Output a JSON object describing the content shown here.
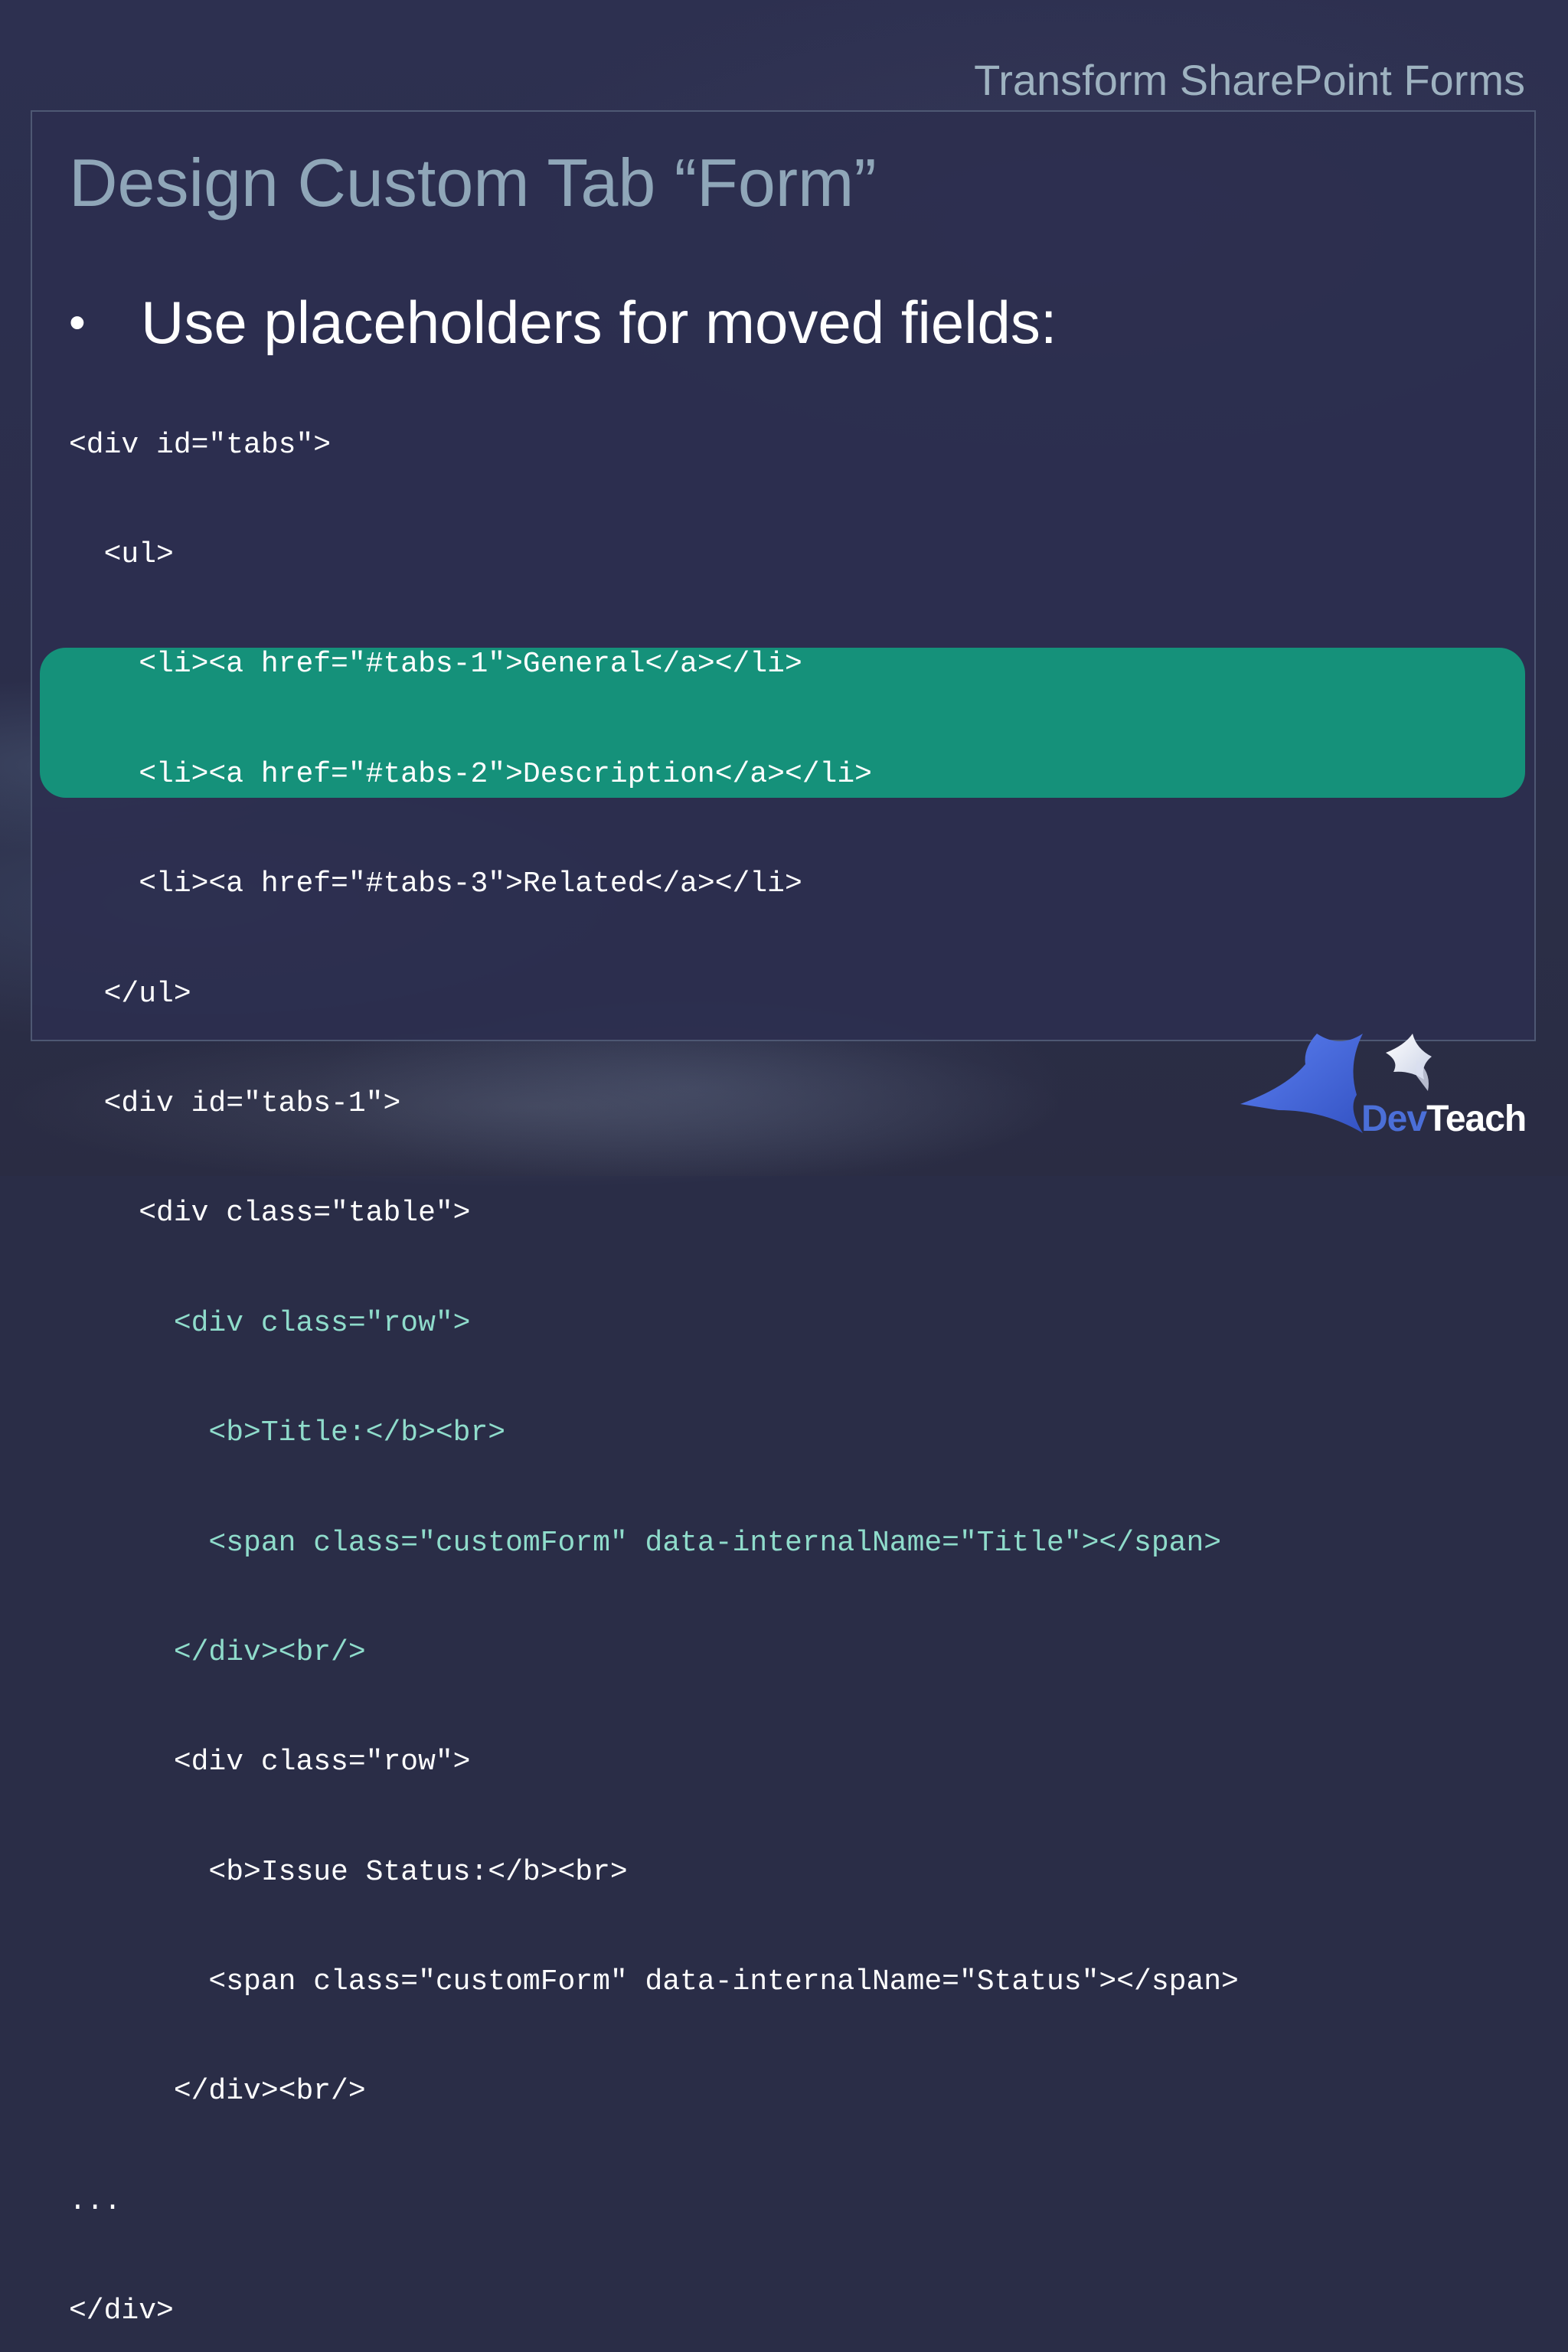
{
  "header": {
    "title": "Transform SharePoint Forms"
  },
  "slide": {
    "title": "Design Custom Tab “Form”",
    "bullet": "Use placeholders for moved fields:",
    "bullet_symbol": "•"
  },
  "code": {
    "lines": [
      "<div id=\"tabs\">",
      "  <ul>",
      "    <li><a href=\"#tabs-1\">General</a></li>",
      "    <li><a href=\"#tabs-2\">Description</a></li>",
      "    <li><a href=\"#tabs-3\">Related</a></li>",
      "  </ul>",
      "  <div id=\"tabs-1\">",
      "    <div class=\"table\">",
      "      <div class=\"row\">",
      "        <b>Title:</b><br>",
      "        <span class=\"customForm\" data-internalName=\"Title\"></span>",
      "      </div><br/>",
      "      <div class=\"row\">",
      "        <b>Issue Status:</b><br>",
      "        <span class=\"customForm\" data-internalName=\"Status\"></span>",
      "      </div><br/>",
      "...",
      "</div>"
    ],
    "highlight_color": "#15917a"
  },
  "logo": {
    "dev": "Dev",
    "teach": "Teach"
  }
}
